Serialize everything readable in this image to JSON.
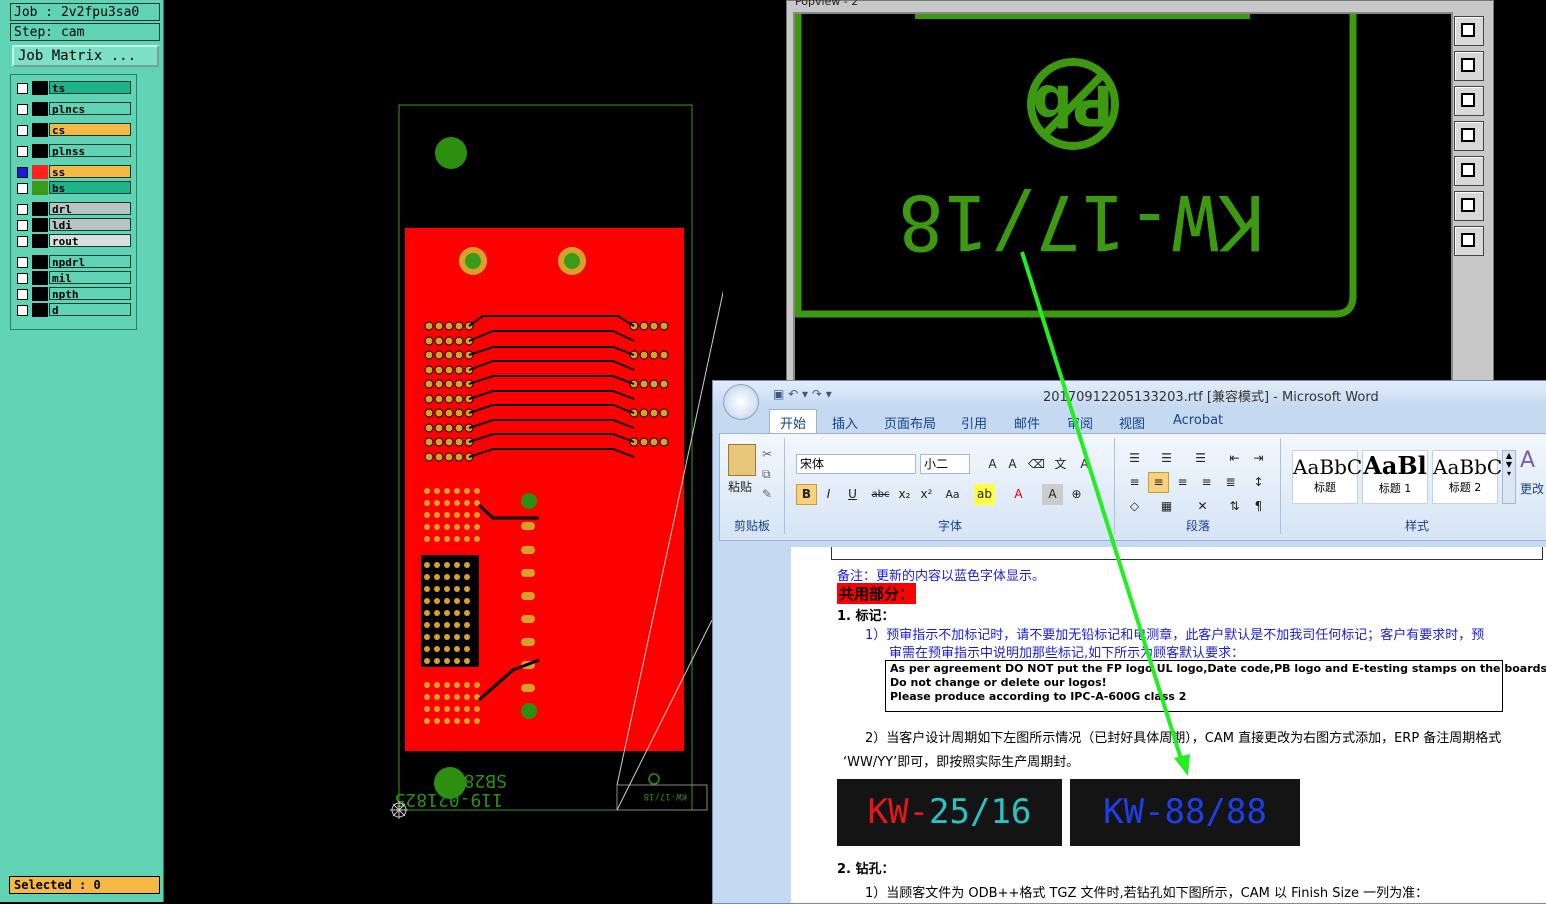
{
  "cam": {
    "job_label": "Job : 2v2fpu3sa0",
    "step_label": "Step: cam",
    "job_matrix_button": "Job Matrix ...",
    "layers": [
      {
        "name": "ts",
        "color": "#1fb38a"
      },
      {
        "name": "plncs",
        "color": "#5fd3b4"
      },
      {
        "name": "cs",
        "color": "#f6b844"
      },
      {
        "name": "plnss",
        "color": "#5fd3b4"
      },
      {
        "name": "ss",
        "color": "#f6b844"
      },
      {
        "name": "bs",
        "color": "#1fb38a"
      },
      {
        "name": "drl",
        "color": "#b9c4c2"
      },
      {
        "name": "ldi",
        "color": "#b9c4c2"
      },
      {
        "name": "rout",
        "color": "#d9dede"
      },
      {
        "name": "npdrl",
        "color": "#5fd3b4"
      },
      {
        "name": "mil",
        "color": "#5fd3b4"
      },
      {
        "name": "npth",
        "color": "#5fd3b4"
      },
      {
        "name": "d",
        "color": "#5fd3b4"
      }
    ],
    "selected_label": "Selected : 0",
    "board_text_1": "SB2800",
    "board_text_2": "119-021825",
    "board_text_3": "KW-17/18"
  },
  "popview": {
    "title": "Popview - 2",
    "date_code": "KW-17/18",
    "logo_text": "Pb"
  },
  "word": {
    "title": "20170912205133203.rtf [兼容模式] - Microsoft Word",
    "tabs": [
      "开始",
      "插入",
      "页面布局",
      "引用",
      "邮件",
      "审阅",
      "视图",
      "Acrobat"
    ],
    "clipboard": {
      "paste": "粘贴",
      "group": "剪贴板"
    },
    "font": {
      "name": "宋体",
      "size": "小二",
      "group": "字体"
    },
    "paragraph_group": "段落",
    "styles": {
      "group": "样式",
      "items": [
        {
          "preview": "AaBbC",
          "name": "标题"
        },
        {
          "preview": "AaBl",
          "name": "标题 1"
        },
        {
          "preview": "AaBbC",
          "name": "标题 2"
        }
      ],
      "change": "更改"
    },
    "doc": {
      "note": "备注：更新的内容以蓝色字体显示。",
      "section_common": "共用部分：",
      "h1": "1.   标记：",
      "p1a": "1）预审指示不加标记时，请不要加无铅标记和电测章，此客户默认是不加我司任何标记；客户有要求时，预",
      "p1b": "审需在预审指示中说明加那些标记,如下所示为顾客默认要求：",
      "box1": "As per agreement DO NOT put the FP logo,UL logo,Date code,PB logo and E-testing stamps on the boards!",
      "box2": "Do not change or delete our logos!",
      "box3": "Please produce according to IPC-A-600G class 2",
      "p2a": "2）当客户设计周期如下左图所示情况（已封好具体周期），CAM 直接更改为右图方式添加，ERP 备注周期格式",
      "p2b": "‘WW/YY’即可，即按照实际生产周期封。",
      "img_left_kw": "KW-",
      "img_left_num": "25/16",
      "img_right": "KW-88/88",
      "h2": "2.   钻孔：",
      "p3": "1）当顾客文件为 ODB++格式 TGZ 文件时,若钻孔如下图所示，CAM 以 Finish Size 一列为准："
    }
  }
}
